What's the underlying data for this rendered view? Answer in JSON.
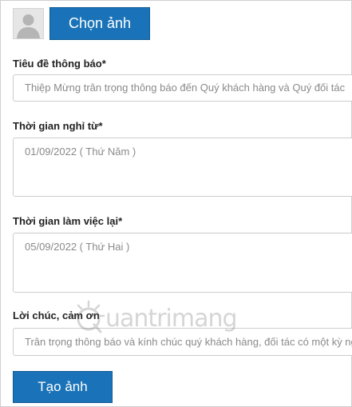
{
  "upload": {
    "choose_label": "Chọn ảnh"
  },
  "form": {
    "title_label": "Tiêu đề thông báo*",
    "title_placeholder": "Thiệp Mừng trân trọng thông báo đến Quý khách hàng và Quý đối tác",
    "off_label": "Thời gian nghỉ từ*",
    "off_placeholder": "01/09/2022 ( Thứ Năm )",
    "back_label": "Thời gian làm việc lại*",
    "back_placeholder": "05/09/2022 ( Thứ Hai )",
    "wish_label": "Lời chúc, cảm ơn",
    "wish_placeholder": "Trân trọng thông báo và kính chúc quý khách hàng, đối tác có một kỳ nghỉ vui vẻ"
  },
  "actions": {
    "create_label": "Tạo ảnh"
  },
  "watermark": {
    "text": "uantrimang",
    "icon": "quantrimang-logo-icon"
  },
  "colors": {
    "button_bg": "#1a73b8",
    "border": "#cccccc",
    "placeholder": "#8a8a8a"
  }
}
